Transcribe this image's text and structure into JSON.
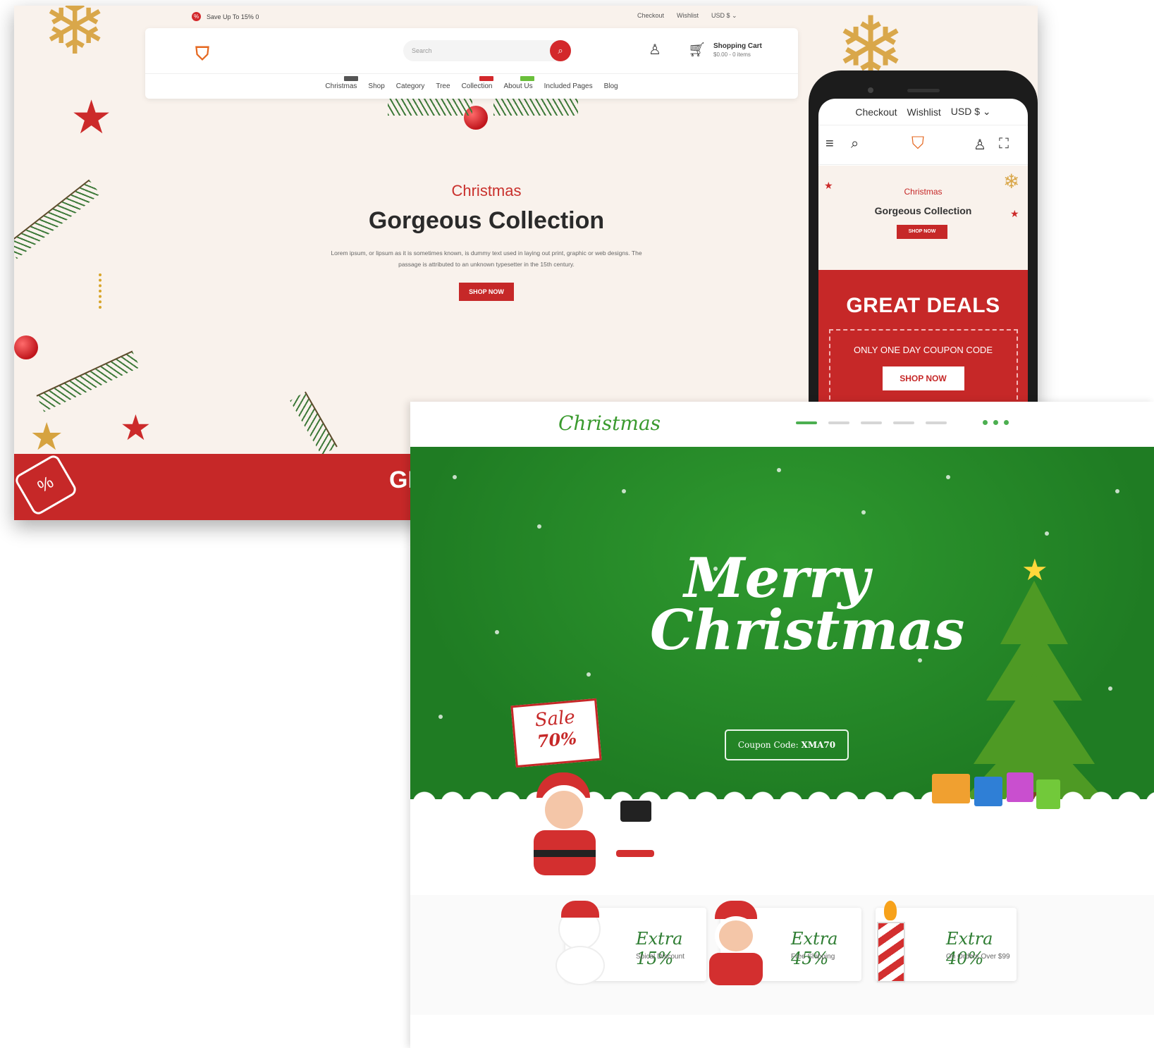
{
  "desktop": {
    "promo_text": "Save Up To 15% 0",
    "promo_icon": "percent-badge-icon",
    "toplinks": [
      "Checkout",
      "Wishlist",
      "USD $ ⌄"
    ],
    "search_placeholder": "Search",
    "cart_title": "Shopping Cart",
    "cart_sub": "$0.00 - 0 items",
    "nav": [
      {
        "label": "Christmas",
        "tag_color": "#555555"
      },
      {
        "label": "Shop",
        "tag_color": ""
      },
      {
        "label": "Category",
        "tag_color": ""
      },
      {
        "label": "Tree",
        "tag_color": ""
      },
      {
        "label": "Collection",
        "tag_color": "#d3282b"
      },
      {
        "label": "About Us",
        "tag_color": "#6abf3b"
      },
      {
        "label": "Included Pages",
        "tag_color": ""
      },
      {
        "label": "Blog",
        "tag_color": ""
      }
    ],
    "hero_kicker": "Christmas",
    "hero_title": "Gorgeous Collection",
    "hero_desc": "Lorem ipsum, or lipsum as it is sometimes known, is dummy text used in laying out print, graphic or web designs. The passage is attributed to an unknown typesetter in the 15th century.",
    "hero_button": "SHOP NOW",
    "strip_text": "GI"
  },
  "phone": {
    "toplinks": [
      "Checkout",
      "Wishlist",
      "USD $ ⌄"
    ],
    "hero_kicker": "Christmas",
    "hero_title": "Gorgeous Collection",
    "hero_button": "SHOP NOW",
    "deals_title": "GREAT DEALS",
    "coupon_text": "ONLY ONE DAY COUPON CODE",
    "shop_button": "SHOP NOW"
  },
  "green_site": {
    "logo": "Christmas",
    "merry": "Merry Christmas",
    "coupon_label": "Coupon Code: ",
    "coupon_code": "XMA70",
    "sale_a": "Sale",
    "sale_b": "70%",
    "offers": [
      {
        "title": "Extra 15%",
        "sub": "Spical Discount",
        "icon": "snowman-icon"
      },
      {
        "title": "Extra 45%",
        "sub": "Free Shipping",
        "icon": "santa-icon"
      },
      {
        "title": "Extra 40%",
        "sub": "On Orders Over $99",
        "icon": "candle-icon"
      }
    ]
  },
  "colors": {
    "accent_red": "#c62828",
    "accent_green": "#2e7d32",
    "logo_orange": "#e5671f"
  }
}
